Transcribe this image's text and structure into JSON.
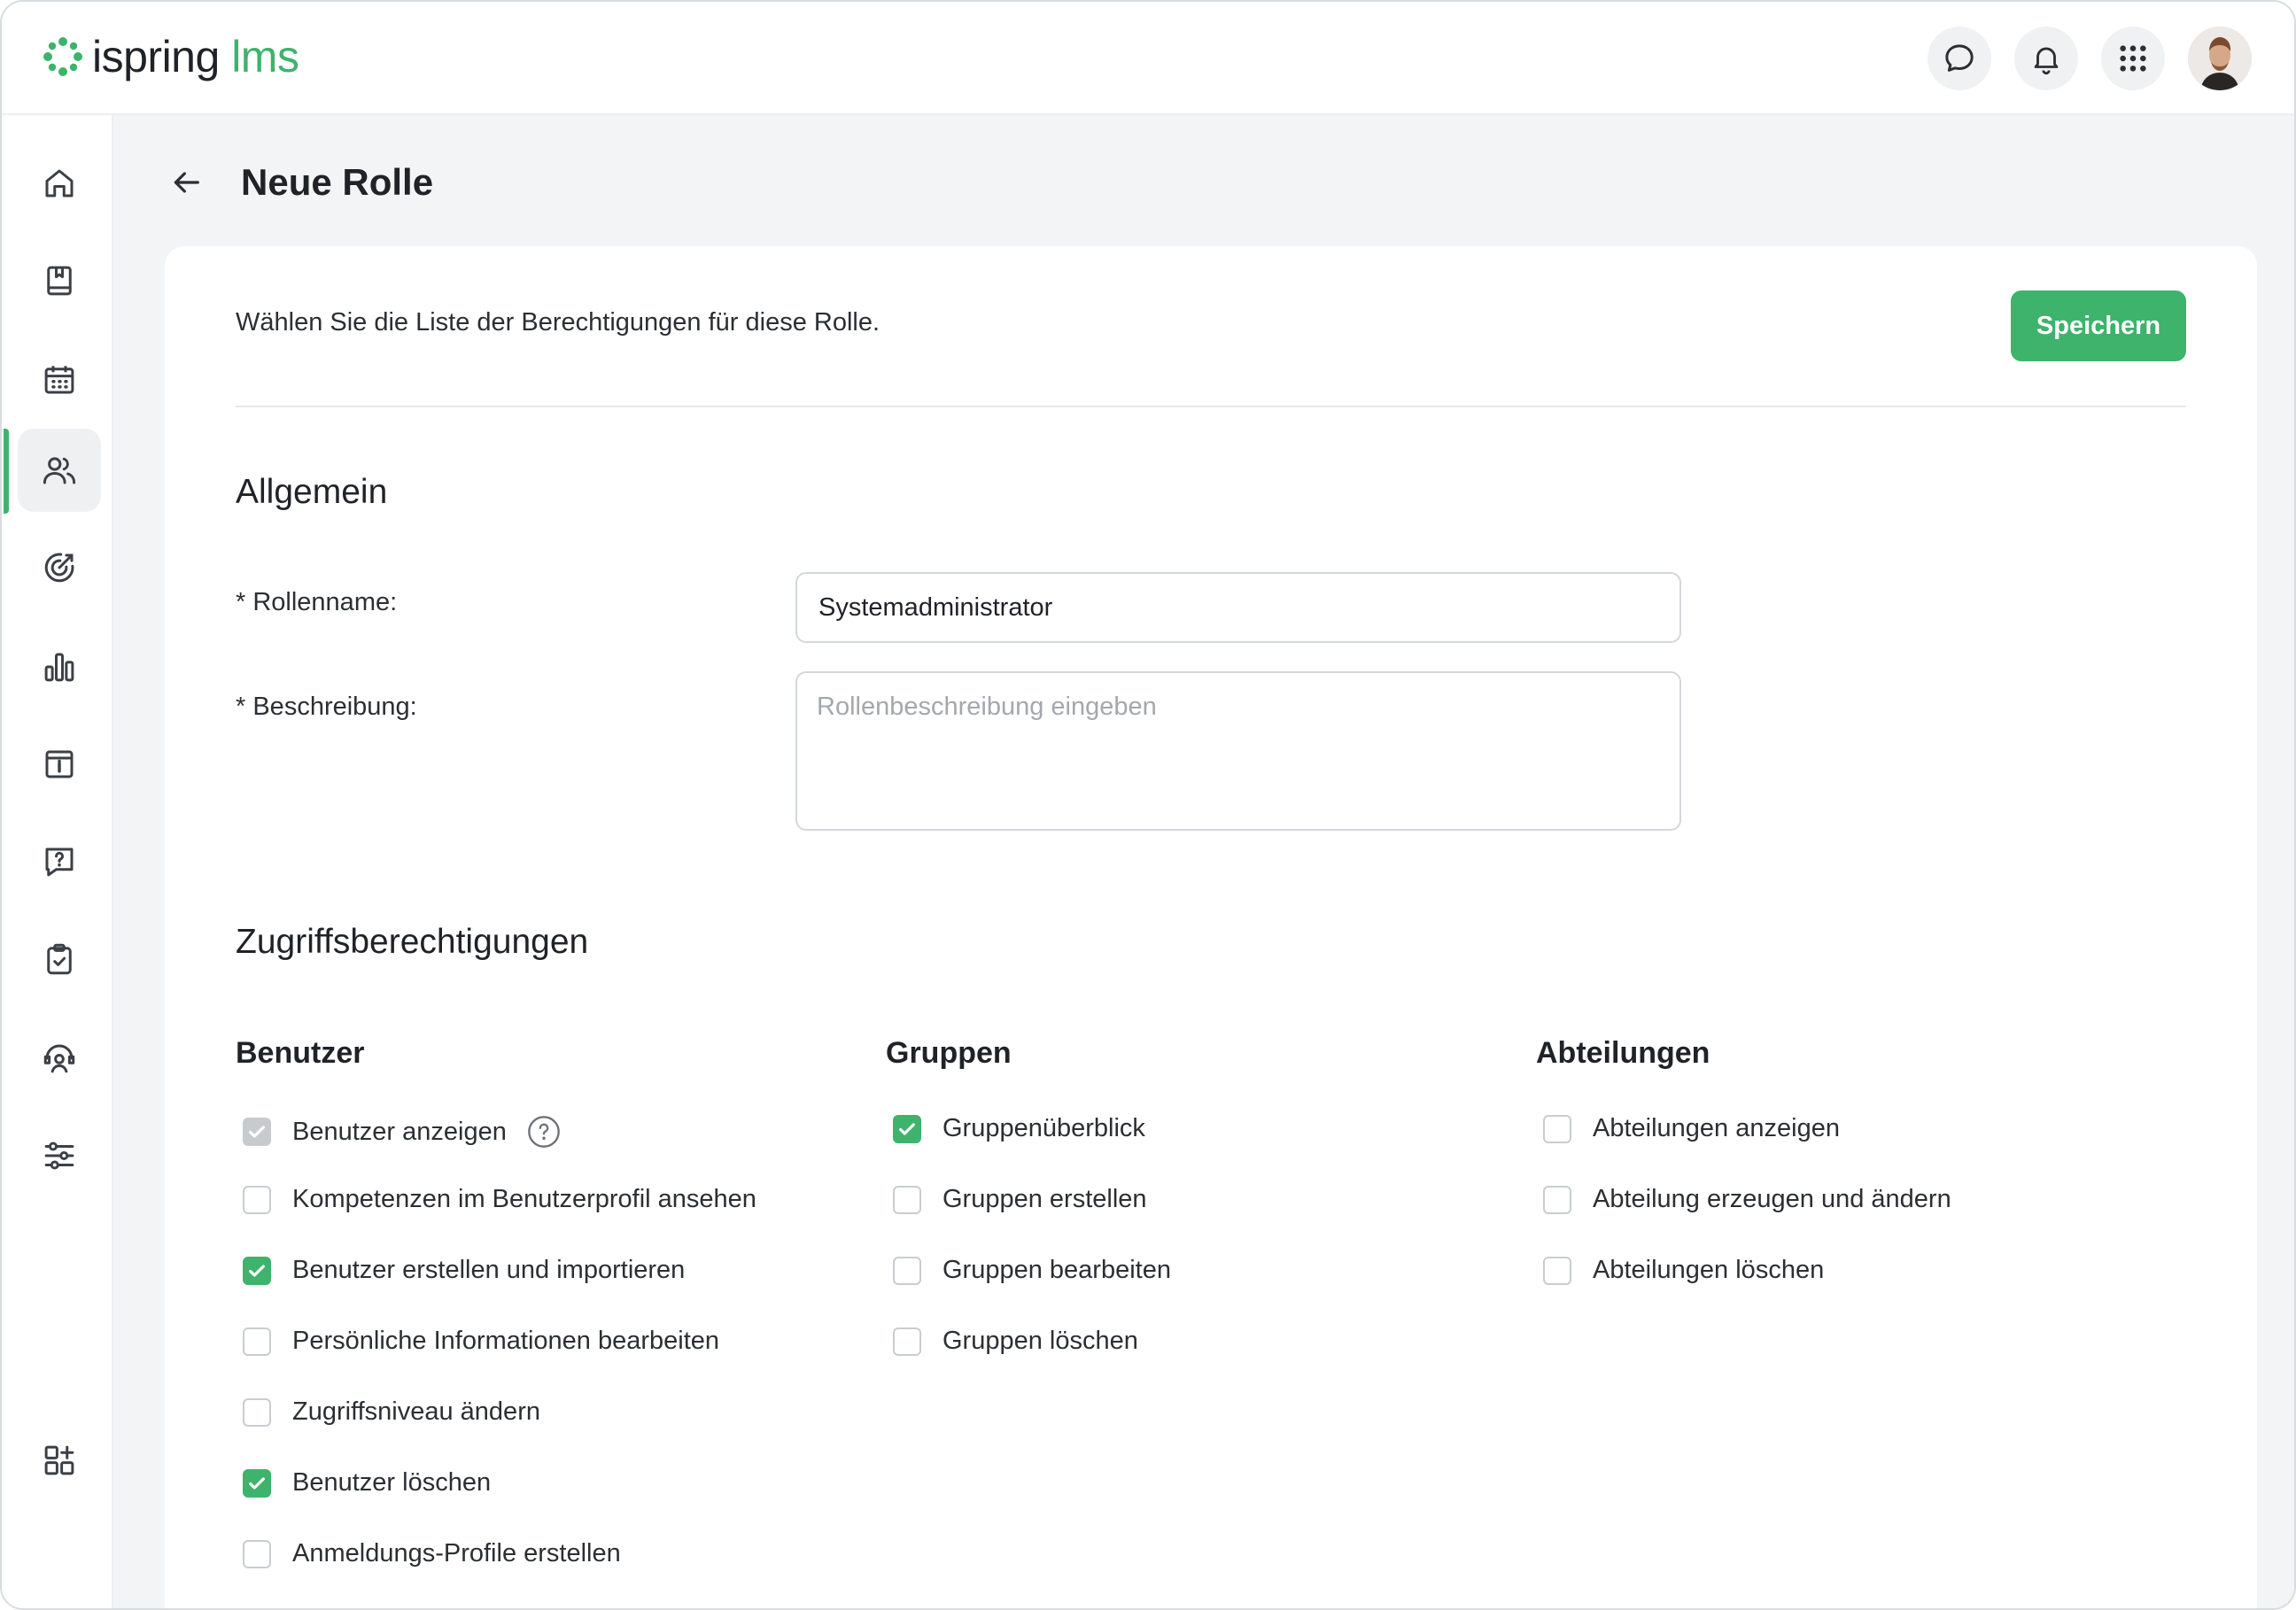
{
  "brand": {
    "part1": "ispring",
    "part2": "lms",
    "accent": "#3db36b"
  },
  "header": {
    "icons": [
      "chat-icon",
      "bell-icon",
      "apps-grid-icon"
    ]
  },
  "sidebar": {
    "items": [
      {
        "name": "home",
        "icon": "home-icon"
      },
      {
        "name": "catalog",
        "icon": "book-icon"
      },
      {
        "name": "calendar",
        "icon": "calendar-icon"
      },
      {
        "name": "users",
        "icon": "users-icon",
        "active": true
      },
      {
        "name": "goals",
        "icon": "target-icon"
      },
      {
        "name": "reports",
        "icon": "bar-chart-icon"
      },
      {
        "name": "info",
        "icon": "info-board-icon"
      },
      {
        "name": "help",
        "icon": "question-icon"
      },
      {
        "name": "tasks",
        "icon": "clipboard-check-icon"
      },
      {
        "name": "support",
        "icon": "headset-icon"
      },
      {
        "name": "settings",
        "icon": "sliders-icon"
      },
      {
        "name": "add-apps",
        "icon": "add-widget-icon"
      }
    ]
  },
  "page": {
    "title": "Neue Rolle",
    "intro": "Wählen Sie die Liste der Berechtigungen für diese Rolle.",
    "save_label": "Speichern"
  },
  "general": {
    "title": "Allgemein",
    "role_name_label": "* Rollenname:",
    "role_name_value": "Systemadministrator",
    "description_label": "* Beschreibung:",
    "description_placeholder": "Rollenbeschreibung eingeben"
  },
  "permissions": {
    "title": "Zugriffsberechtigungen",
    "columns": [
      {
        "title": "Benutzer",
        "items": [
          {
            "label": "Benutzer anzeigen",
            "state": "disabled-checked",
            "help": true
          },
          {
            "label": "Kompetenzen im Benutzerprofil ansehen",
            "state": "unchecked"
          },
          {
            "label": "Benutzer erstellen und importieren",
            "state": "checked"
          },
          {
            "label": "Persönliche Informationen bearbeiten",
            "state": "unchecked"
          },
          {
            "label": "Zugriffsniveau ändern",
            "state": "unchecked"
          },
          {
            "label": "Benutzer löschen",
            "state": "checked"
          },
          {
            "label": "Anmeldungs-Profile erstellen",
            "state": "unchecked"
          }
        ]
      },
      {
        "title": "Gruppen",
        "items": [
          {
            "label": "Gruppenüberblick",
            "state": "checked"
          },
          {
            "label": "Gruppen erstellen",
            "state": "unchecked"
          },
          {
            "label": "Gruppen bearbeiten",
            "state": "unchecked"
          },
          {
            "label": "Gruppen löschen",
            "state": "unchecked"
          }
        ]
      },
      {
        "title": "Abteilungen",
        "items": [
          {
            "label": "Abteilungen anzeigen",
            "state": "unchecked"
          },
          {
            "label": "Abteilung erzeugen und ändern",
            "state": "unchecked"
          },
          {
            "label": "Abteilungen löschen",
            "state": "unchecked"
          }
        ]
      }
    ]
  }
}
